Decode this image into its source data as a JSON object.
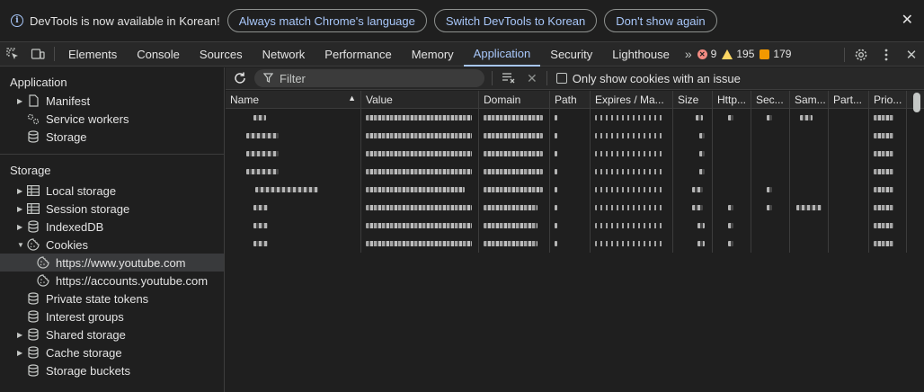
{
  "infobar": {
    "message": "DevTools is now available in Korean!",
    "btn_match": "Always match Chrome's language",
    "btn_switch": "Switch DevTools to Korean",
    "btn_dismiss": "Don't show again"
  },
  "tabs": [
    "Elements",
    "Console",
    "Sources",
    "Network",
    "Performance",
    "Memory",
    "Application",
    "Security",
    "Lighthouse"
  ],
  "active_tab": "Application",
  "counters": {
    "errors": "9",
    "warnings": "195",
    "issues": "179"
  },
  "sidebar": {
    "application_header": "Application",
    "application_items": [
      "Manifest",
      "Service workers",
      "Storage"
    ],
    "storage_header": "Storage",
    "storage_items": {
      "local": "Local storage",
      "session": "Session storage",
      "indexeddb": "IndexedDB",
      "cookies": "Cookies",
      "cookie_youtube": "https://www.youtube.com",
      "cookie_accounts": "https://accounts.youtube.com",
      "private_tokens": "Private state tokens",
      "interest": "Interest groups",
      "shared": "Shared storage",
      "cache": "Cache storage",
      "buckets": "Storage buckets"
    }
  },
  "filter": {
    "placeholder": "Filter",
    "only_issue_label": "Only show cookies with an issue"
  },
  "columns": [
    "Name",
    "Value",
    "Domain",
    "Path",
    "Expires / Ma...",
    "Size",
    "Http...",
    "Sec...",
    "Sam...",
    "Part...",
    "Prio..."
  ],
  "colors": {
    "accent": "#a8c7fa",
    "error": "#f28b82",
    "warning": "#fdd663",
    "issue": "#f29900"
  }
}
